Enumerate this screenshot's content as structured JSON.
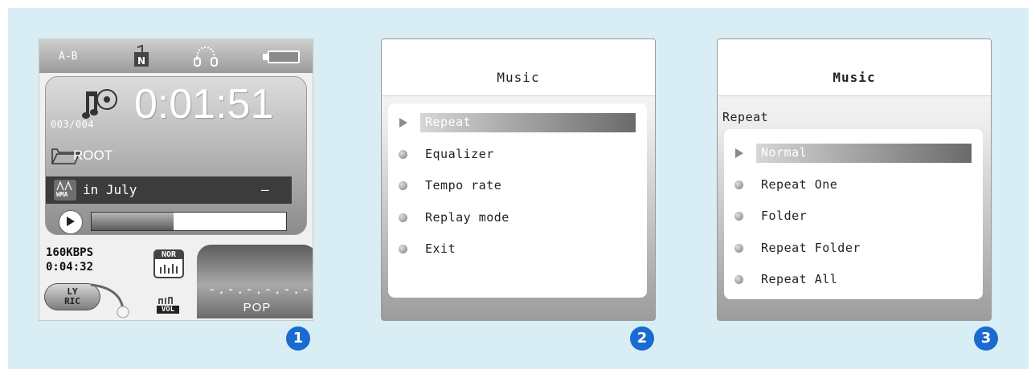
{
  "colors": {
    "background": "#d8edf4",
    "badge": "#1a6bd1",
    "highlight": "#6a6a6a"
  },
  "player": {
    "repeat_ab": "A-B",
    "icons": {
      "eq": "n-equalizer-icon",
      "loop": "headphones-icon",
      "battery": "battery-icon"
    },
    "track_number": "003/004",
    "elapsed": "0:01:51",
    "folder": "ROOT",
    "format_label": "WMA",
    "song_title": "in July",
    "song_dash": "–",
    "progress": 0.42,
    "bitrate": "160KBPS",
    "total_time": "0:04:32",
    "eq_mode": "NOR",
    "lyric_label": [
      "LY",
      "RIC"
    ],
    "vol_label": "VOL",
    "eq_dots": "-.-.-.-.-.-",
    "eq_preset": "POP"
  },
  "menu": {
    "title": "Music",
    "items": [
      "Repeat",
      "Equalizer",
      "Tempo rate",
      "Replay mode",
      "Exit"
    ],
    "selected": "Repeat"
  },
  "repeat_menu": {
    "title": "Music",
    "section": "Repeat",
    "items": [
      "Normal",
      "Repeat One",
      "Folder",
      "Repeat Folder",
      "Repeat All"
    ],
    "selected": "Normal"
  },
  "badges": [
    "1",
    "2",
    "3"
  ]
}
